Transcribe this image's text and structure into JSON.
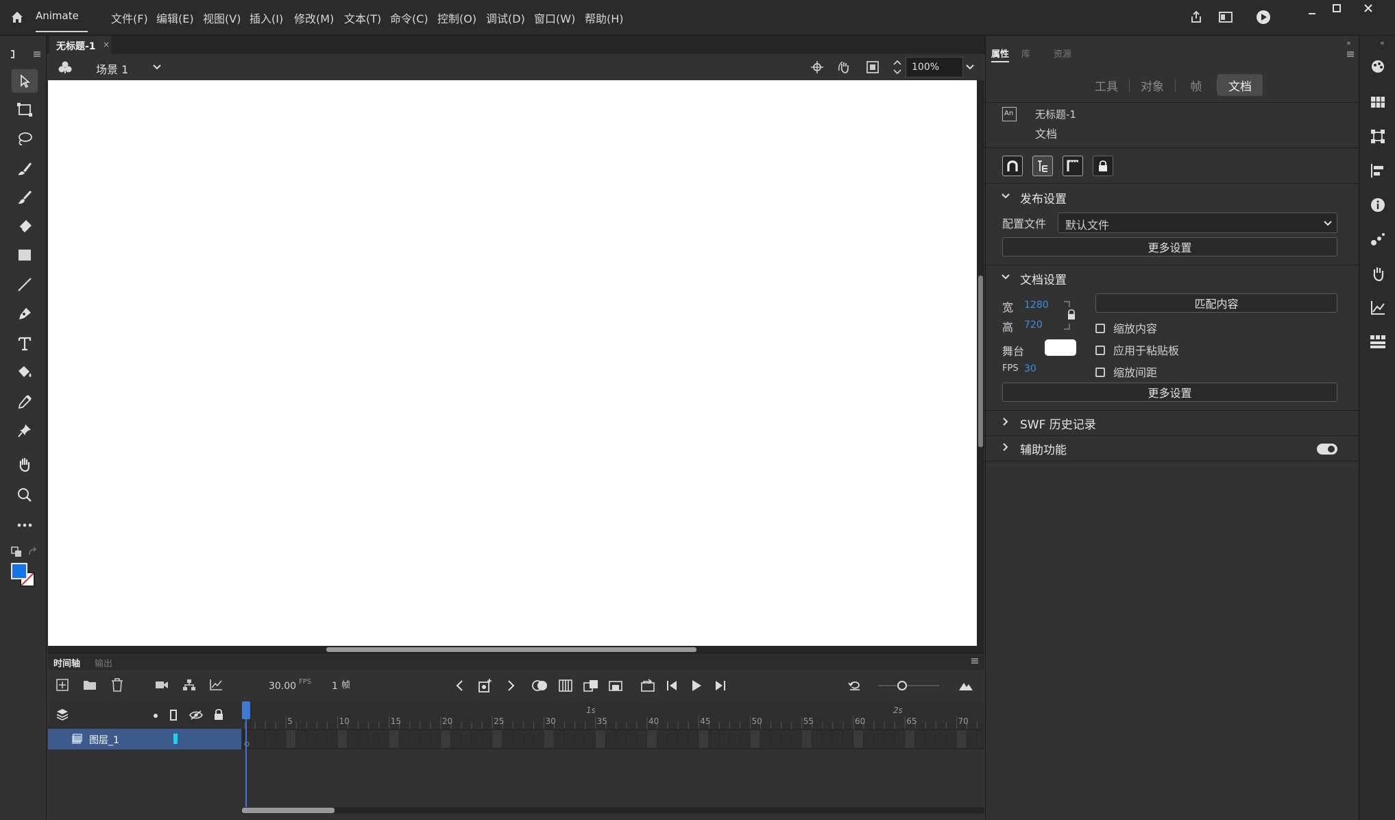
{
  "app": {
    "name": "Animate"
  },
  "menu": [
    "文件(F)",
    "编辑(E)",
    "视图(V)",
    "插入(I)",
    "修改(M)",
    "文本(T)",
    "命令(C)",
    "控制(O)",
    "调试(D)",
    "窗口(W)",
    "帮助(H)"
  ],
  "document_tab": {
    "title": "无标题-1",
    "close": "×"
  },
  "scene": {
    "name": "场景 1",
    "zoom": "100%"
  },
  "timeline": {
    "tabs": [
      "时间轴",
      "输出"
    ],
    "fps": "30.00",
    "fps_unit": "FPS",
    "frame": "1",
    "frame_unit": "帧",
    "ruler_numbers": [
      "5",
      "10",
      "15",
      "20",
      "25",
      "30",
      "35",
      "40",
      "45",
      "50",
      "55",
      "60",
      "65",
      "70"
    ],
    "second_markers": [
      "1s",
      "2s"
    ],
    "layer": {
      "name": "图层_1"
    }
  },
  "properties": {
    "tabs": [
      "属性",
      "库",
      "资源"
    ],
    "segments": [
      "工具",
      "对象",
      "帧",
      "文档"
    ],
    "active_segment": "文档",
    "doc_badge": "An",
    "doc_name": "无标题-1",
    "doc_type": "文档",
    "publish": {
      "title": "发布设置",
      "profile_label": "配置文件",
      "profile_value": "默认文件",
      "more": "更多设置"
    },
    "doc_settings": {
      "title": "文档设置",
      "width_label": "宽",
      "width": "1280",
      "height_label": "高",
      "height": "720",
      "stage_label": "舞台",
      "stage_color": "#ffffff",
      "fps_label": "FPS",
      "fps": "30",
      "match_content": "匹配内容",
      "scale_content": "缩放内容",
      "apply_pasteboard": "应用于粘贴板",
      "scale_spacing": "缩放间距",
      "more": "更多设置"
    },
    "swf_history": "SWF 历史记录",
    "accessibility": "辅助功能"
  },
  "colors": {
    "stroke": "#1473e6",
    "accent": "#3d8ee0",
    "layer_sel": "#3c5a8c",
    "playhead": "#3e7bd6"
  }
}
